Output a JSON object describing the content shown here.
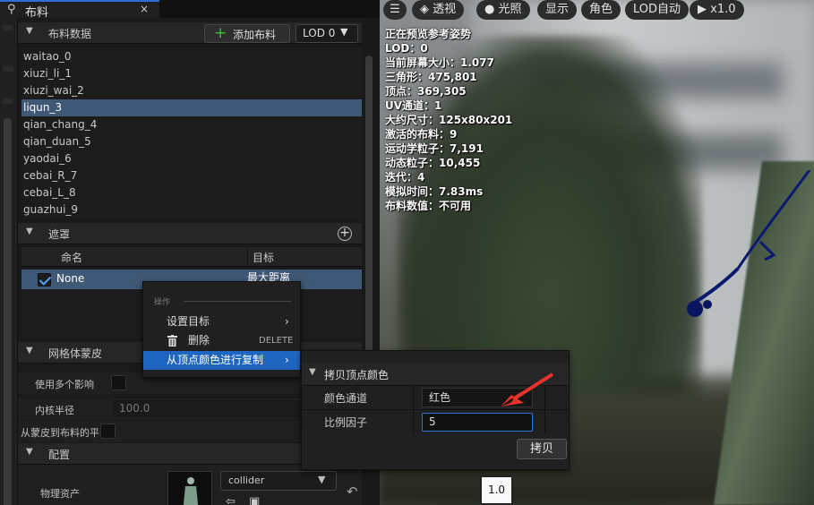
{
  "tab": {
    "icon": "hanger-icon",
    "title": "布料",
    "close": "×"
  },
  "cloth_data": {
    "title": "布料数据",
    "add_button": "添加布料",
    "lod_select": "LOD 0",
    "items": [
      "waitao_0",
      "xiuzi_li_1",
      "xiuzi_wai_2",
      "liqun_3",
      "qian_chang_4",
      "qian_duan_5",
      "yaodai_6",
      "cebai_R_7",
      "cebai_L_8",
      "guazhui_9"
    ],
    "selected_index": 3
  },
  "mask": {
    "title": "遮罩",
    "columns": [
      "命名",
      "目标"
    ],
    "row": {
      "name": "None",
      "target": "最大距离",
      "checked": true
    }
  },
  "mesh_skin": {
    "title": "网格体蒙皮",
    "use_multiple": "使用多个影响",
    "inner_radius_label": "内核半径",
    "inner_radius_value": "100.0",
    "skin_to_cloth": "从蒙皮到布料的平"
  },
  "config": {
    "title": "配置",
    "physics_asset_label": "物理资产",
    "physics_asset_value": "collider"
  },
  "viewport": {
    "toolbar": [
      "透视",
      "光照",
      "显示",
      "角色",
      "LOD自动",
      "x1.0"
    ],
    "stats": [
      "正在预览参考姿势",
      "LOD：0",
      "当前屏幕大小：1.077",
      "三角形：475,801",
      "顶点：369,305",
      "UV通道：1",
      "大约尺寸：125x80x201",
      "激活的布料：9",
      "运动学粒子：7,191",
      "动态粒子：10,455",
      "迭代：4",
      "模拟时间：7.83ms",
      "布料数值：不可用"
    ]
  },
  "context_menu": {
    "section": "操作",
    "items": [
      {
        "label": "设置目标",
        "submenu": true
      },
      {
        "label": "删除",
        "shortcut": "DELETE",
        "icon": "trash-icon"
      },
      {
        "label": "从顶点颜色进行复制",
        "submenu": true,
        "highlighted": true
      }
    ]
  },
  "copy_vertex_color": {
    "title": "拷贝顶点颜色",
    "channel_label": "颜色通道",
    "channel_value": "红色",
    "scale_label": "比例因子",
    "scale_value": "5",
    "copy_button": "拷贝"
  },
  "zoom_badge": "1.0",
  "colors": {
    "accent": "#1e66c2",
    "selection": "#3f5875",
    "arrow": "#e8332a",
    "add_green": "#3fbf3f"
  }
}
